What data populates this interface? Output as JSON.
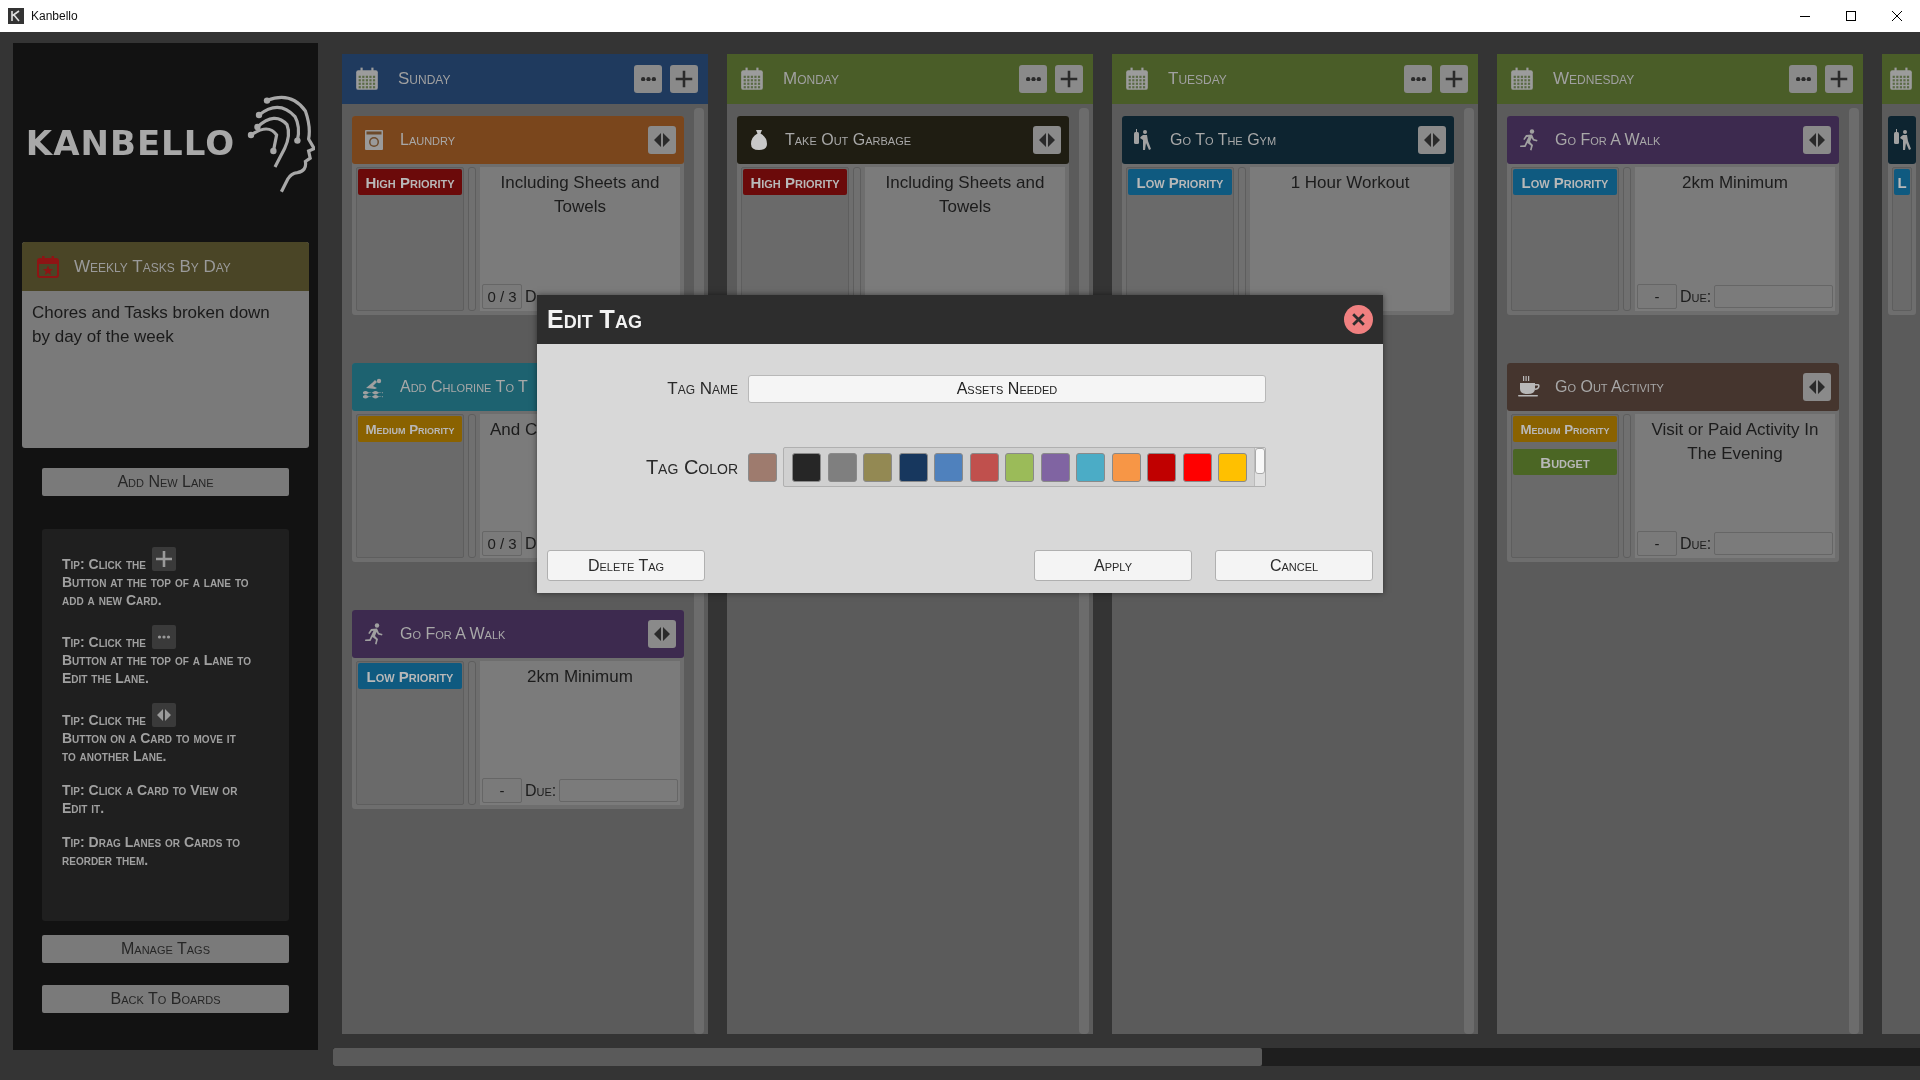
{
  "window": {
    "title": "Kanbello"
  },
  "sidebar": {
    "logo": "KANBELLO",
    "board": {
      "title": "Weekly Tasks By Day",
      "description": "Chores and Tasks broken down by day of the week"
    },
    "add_lane_button": "Add New Lane",
    "tips": [
      {
        "text": "Tip: Click the",
        "kind": "plus",
        "rest": "Button at the top of a lane to add a new Card."
      },
      {
        "text": "Tip: Click the",
        "kind": "dots",
        "rest": "Button at the top of a Lane to Edit the Lane."
      },
      {
        "text": "Tip: Click the",
        "kind": "arrows",
        "rest": "Button on a Card to move it to another Lane."
      },
      {
        "text": "Tip: Click a Card to View or Edit it."
      },
      {
        "text": "Tip: Drag Lanes or Cards to reorder them."
      }
    ],
    "buttons": [
      "Manage Tags",
      "Back To Boards"
    ]
  },
  "lanes": [
    {
      "title": "Sunday",
      "color": "#1f3a5e",
      "cards": [
        {
          "title": "Laundry",
          "kind": "washer",
          "color": "#7a461c",
          "tags": [
            {
              "label": "High Priority",
              "color": "#6b0a0a"
            }
          ],
          "description": "Including Sheets and Towels",
          "centered": true,
          "footer": {
            "button": "0 / 3",
            "due_label": "D"
          }
        },
        {
          "title": "Add Chlorine To T",
          "kind": "swimmer",
          "color": "#1d6270",
          "tags": [
            {
              "label": "Medium Priority",
              "color": "#8a6200"
            }
          ],
          "description": "And C",
          "centered": false,
          "move_button": false,
          "footer": {
            "button": "0 / 3",
            "due_label": "D"
          }
        },
        {
          "title": "Go For A Walk",
          "kind": "runner",
          "color": "#3d2a4f",
          "tags": [
            {
              "label": "Low Priority",
              "color": "#0f5a80"
            }
          ],
          "description": "2km Minimum",
          "centered": true,
          "footer": {
            "button": "-",
            "due_label": "Due:",
            "date_field": true
          }
        }
      ]
    },
    {
      "title": "Monday",
      "color": "#4a5d28",
      "cards": [
        {
          "title": "Take Out Garbage",
          "kind": "bag",
          "color": "#1f1d12",
          "tags": [
            {
              "label": "High Priority",
              "color": "#6b0a0a"
            }
          ],
          "description": "Including Sheets and Towels",
          "centered": true
        }
      ]
    },
    {
      "title": "Tuesday",
      "color": "#4a5d28",
      "cards": [
        {
          "title": "Go To The Gym",
          "kind": "gym",
          "color": "#0d2430",
          "tags": [
            {
              "label": "Low Priority",
              "color": "#0f5a80"
            }
          ],
          "description": "1 Hour Workout",
          "centered": true
        }
      ]
    },
    {
      "title": "Wednesday",
      "color": "#4a5d28",
      "cards": [
        {
          "title": "Go For A Walk",
          "kind": "runner",
          "color": "#3d2a4f",
          "tags": [
            {
              "label": "Low Priority",
              "color": "#0f5a80"
            }
          ],
          "description": "2km Minimum",
          "centered": true,
          "footer": {
            "button": "-",
            "due_label": "Due:",
            "date_field": true
          }
        },
        {
          "title": "Go Out Activity",
          "kind": "cup",
          "color": "#45352e",
          "tags": [
            {
              "label": "Medium Priority",
              "color": "#8a6200"
            },
            {
              "label": "Budget",
              "color": "#4b6624"
            }
          ],
          "description": "Visit or Paid Activity In The Evening",
          "centered": true,
          "footer": {
            "button": "-",
            "due_label": "Due:",
            "date_field": true
          }
        }
      ]
    },
    {
      "color": "#4a5d28",
      "cards": [
        {
          "kind": "gym",
          "color": "#0d2430",
          "tags": [
            {
              "label": "L",
              "color": "#0f5a80"
            }
          ]
        }
      ]
    }
  ],
  "dialog": {
    "title": "Edit Tag",
    "name_label": "Tag Name",
    "name_value": "Assets Needed",
    "color_label": "Tag Color",
    "current_swatch": {
      "color": "#9e7b6e"
    },
    "palette": [
      {
        "color": "#262626"
      },
      {
        "color": "#7f7f7f"
      },
      {
        "color": "#938953"
      },
      {
        "color": "#17375e"
      },
      {
        "color": "#4f81bd"
      },
      {
        "color": "#c0504d"
      },
      {
        "color": "#9bbb59"
      },
      {
        "color": "#8064a2"
      },
      {
        "color": "#4bacc6"
      },
      {
        "color": "#f79646"
      },
      {
        "color": "#c00000"
      },
      {
        "color": "#ff0000"
      },
      {
        "color": "#ffc000"
      }
    ],
    "buttons": [
      "Delete Tag",
      "Apply",
      "Cancel"
    ]
  }
}
